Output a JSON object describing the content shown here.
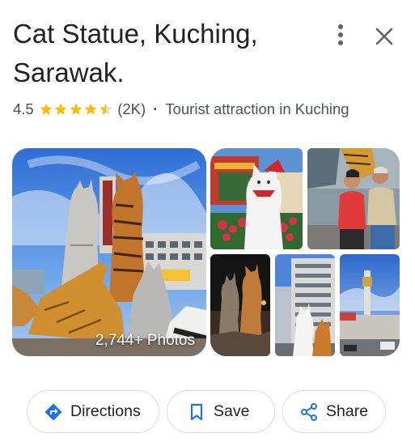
{
  "place": {
    "title": "Cat Statue, Kuching, Sarawak.",
    "rating": "4.5",
    "stars": 4.5,
    "review_count": "(2K)",
    "separator": "·",
    "category": "Tourist attraction in Kuching"
  },
  "header_icons": {
    "more": "more-vert-icon",
    "close": "close-icon"
  },
  "gallery": {
    "photo_count_label": "2,744+ Photos"
  },
  "actions": [
    {
      "label": "Directions",
      "icon": "directions-icon"
    },
    {
      "label": "Save",
      "icon": "bookmark-icon"
    },
    {
      "label": "Share",
      "icon": "share-icon"
    }
  ],
  "colors": {
    "star": "#fbbc04",
    "accent": "#1a73e8",
    "text": "#202124",
    "secondary_text": "#4d5156",
    "border": "#dadce0"
  }
}
